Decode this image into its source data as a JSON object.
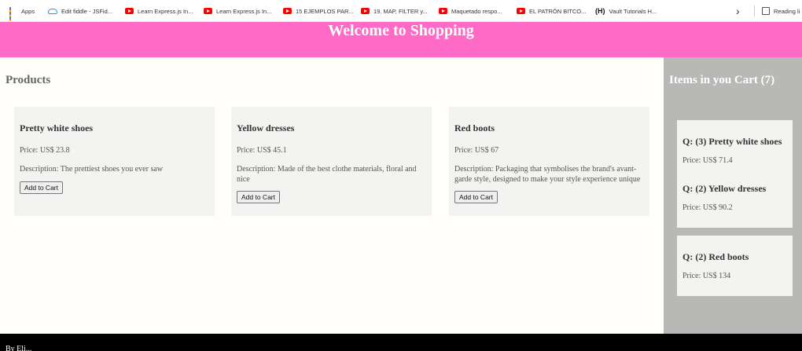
{
  "bookmarks": {
    "apps": "Apps",
    "items": [
      {
        "label": "Edit fiddle - JSFid...",
        "icon": "cloud-icon"
      },
      {
        "label": "Learn Express.js In...",
        "icon": "youtube-icon"
      },
      {
        "label": "Learn Express.js In...",
        "icon": "youtube-icon"
      },
      {
        "label": "15 EJEMPLOS PAR...",
        "icon": "youtube-icon"
      },
      {
        "label": "19. MAP, FILTER y...",
        "icon": "youtube-icon"
      },
      {
        "label": "Maquetado respo...",
        "icon": "youtube-icon"
      },
      {
        "label": "EL PATRÓN BITCO...",
        "icon": "youtube-icon"
      },
      {
        "label": "Vault Tutorials   H...",
        "icon": "vault-icon"
      }
    ],
    "reading_list": "Reading li"
  },
  "header": {
    "title": "Welcome to Shopping",
    "color": "#ff6ac7"
  },
  "products": {
    "title": "Products",
    "items": [
      {
        "name": "Pretty white shoes",
        "price": "Price: US$ 23.8",
        "description": "Description: The prettiest shoes you ever saw",
        "button": "Add to Cart"
      },
      {
        "name": "Yellow dresses",
        "price": "Price: US$ 45.1",
        "description": "Description: Made of the best clothe materials, floral and nice",
        "button": "Add to Cart"
      },
      {
        "name": "Red boots",
        "price": "Price: US$ 67",
        "description": "Description: Packaging that symbolises the brand's avant-garde style, designed to make your style experience unique",
        "button": "Add to Cart"
      }
    ]
  },
  "cart": {
    "title": "Items in you Cart (7)",
    "items": [
      {
        "name": "Q: (3) Pretty white shoes",
        "price": "Price: US$ 71.4"
      },
      {
        "name": "Q: (2) Yellow dresses",
        "price": "Price: US$ 90.2"
      },
      {
        "name": "Q: (2) Red boots",
        "price": "Price: US$ 134"
      }
    ]
  },
  "footer": {
    "text": "By Eli..."
  }
}
